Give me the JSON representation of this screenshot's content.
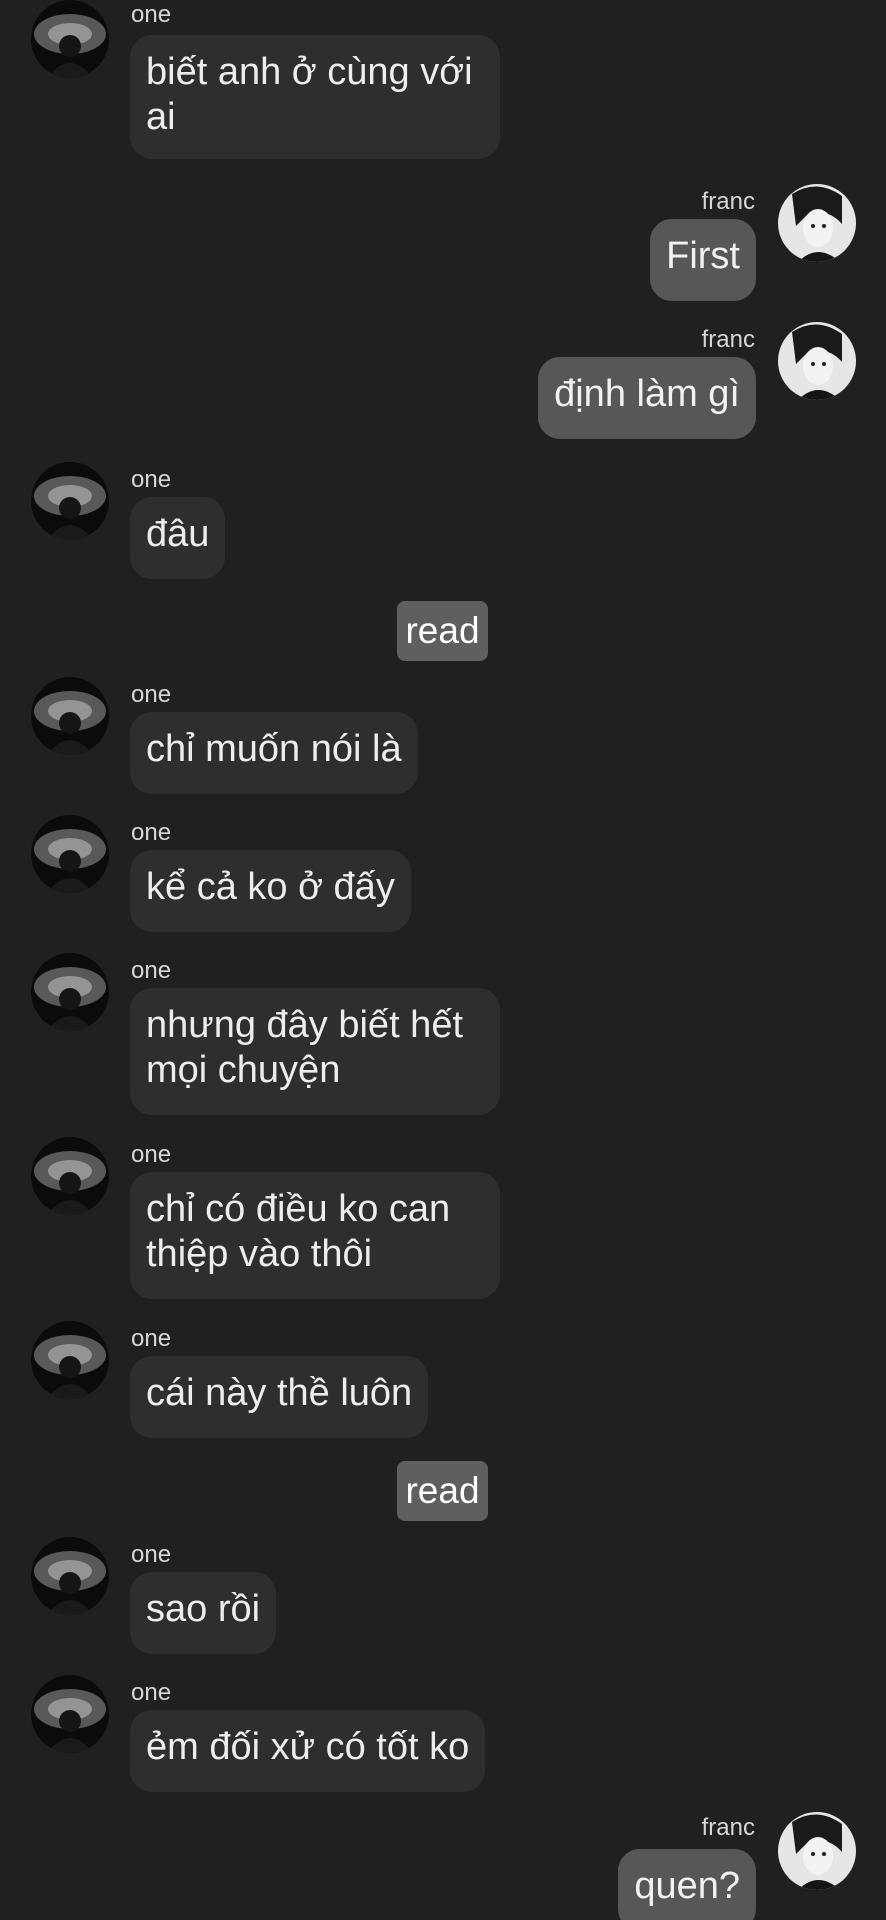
{
  "thread": {
    "read_label": "read",
    "messages": [
      {
        "side": "left",
        "sender": "one",
        "lines": [
          "biết anh ở cùng với",
          "ai"
        ]
      },
      {
        "side": "right",
        "sender": "franc",
        "lines": [
          "First"
        ]
      },
      {
        "side": "right",
        "sender": "franc",
        "lines": [
          "định làm gì"
        ]
      },
      {
        "side": "left",
        "sender": "one",
        "lines": [
          "đâu"
        ]
      },
      {
        "side": "left",
        "sender": "one",
        "lines": [
          "chỉ muốn nói là"
        ]
      },
      {
        "side": "left",
        "sender": "one",
        "lines": [
          "kể cả ko ở đấy"
        ]
      },
      {
        "side": "left",
        "sender": "one",
        "lines": [
          "nhưng đây biết hết",
          "mọi chuyện"
        ]
      },
      {
        "side": "left",
        "sender": "one",
        "lines": [
          "chỉ có điều ko can",
          "thiệp vào thôi"
        ]
      },
      {
        "side": "left",
        "sender": "one",
        "lines": [
          "cái này thề luôn"
        ]
      },
      {
        "side": "left",
        "sender": "one",
        "lines": [
          "sao rồi"
        ]
      },
      {
        "side": "left",
        "sender": "one",
        "lines": [
          "ẻm đối xử có tốt ko"
        ]
      },
      {
        "side": "right",
        "sender": "franc",
        "lines": [
          "quen?"
        ]
      }
    ]
  },
  "avatars": {
    "one": "avatar-one-icon",
    "franc": "avatar-franc-icon"
  },
  "colors": {
    "background": "#202020",
    "incoming_bubble": "#2e2e2e",
    "outgoing_bubble": "#575757",
    "read_badge": "#5f5f5f"
  }
}
